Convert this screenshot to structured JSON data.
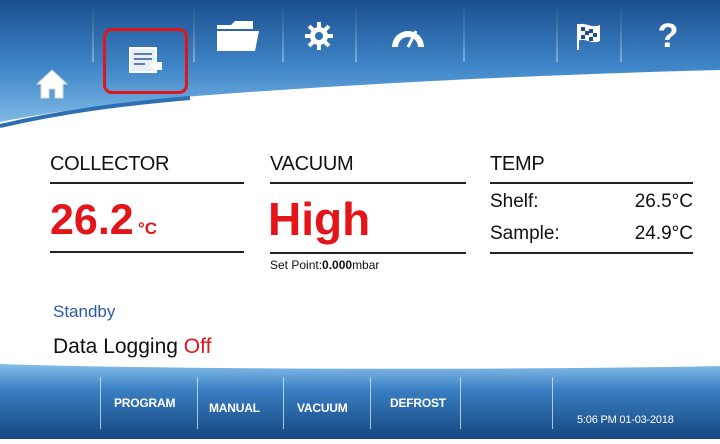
{
  "toolbar": {
    "tabs": [
      {
        "icon": "home-icon"
      },
      {
        "icon": "data-export-icon"
      },
      {
        "icon": "folder-icon"
      },
      {
        "icon": "gear-icon"
      },
      {
        "icon": "gauge-icon"
      },
      {
        "icon": "checkered-flag-icon"
      },
      {
        "icon": "help-icon",
        "label": "?"
      }
    ],
    "accent": "#1f5fa8"
  },
  "collector": {
    "title": "COLLECTOR",
    "value": "26.2",
    "unit": "°C"
  },
  "vacuum": {
    "title": "VACUUM",
    "value": "High",
    "set_point_label": "Set Point:",
    "set_point_value": "0.000",
    "set_point_unit": "mbar"
  },
  "temp": {
    "title": "TEMP",
    "shelf_label": "Shelf:",
    "shelf_value": "26.5°C",
    "sample_label": "Sample:",
    "sample_value": "24.9°C"
  },
  "status": {
    "state": "Standby",
    "logging_label": "Data Logging",
    "logging_value": "Off"
  },
  "bottom": {
    "tabs": [
      "PROGRAM",
      "MANUAL",
      "VACUUM",
      "DEFROST"
    ],
    "datetime": "5:06 PM 01-03-2018"
  }
}
